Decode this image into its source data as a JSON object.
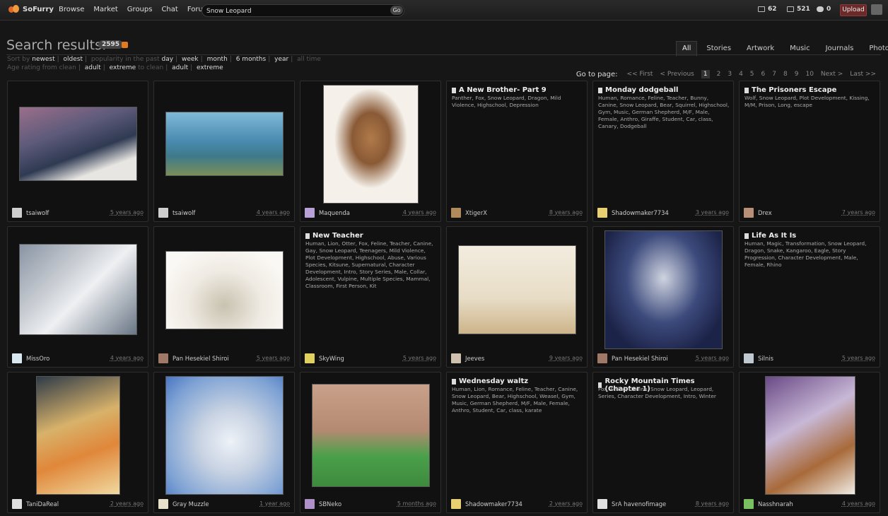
{
  "brand": {
    "name": "SoFurry"
  },
  "nav": [
    "Browse",
    "Market",
    "Groups",
    "Chat",
    "Forum"
  ],
  "search": {
    "value": "Snow Leopard",
    "go_label": "Go"
  },
  "stats": {
    "submissions": "62",
    "messages": "521",
    "comments": "0"
  },
  "upload_label": "Upload",
  "header": {
    "title": "Search results:",
    "count": "2595"
  },
  "tabs": [
    "All",
    "Stories",
    "Artwork",
    "Music",
    "Journals",
    "Photos"
  ],
  "sort": {
    "label": "Sort by",
    "options": [
      "newest",
      "oldest",
      "popularity in the past",
      "day",
      "week",
      "month",
      "6 months",
      "year",
      "all time"
    ]
  },
  "rating": {
    "label": "Age rating from",
    "from": [
      "clean",
      "adult",
      "extreme"
    ],
    "to_label": "to",
    "to": [
      "clean",
      "adult",
      "extreme"
    ]
  },
  "pager": {
    "label": "Go to page:",
    "first": "<< First",
    "prev": "< Previous",
    "pages": [
      "1",
      "2",
      "3",
      "4",
      "5",
      "6",
      "7",
      "8",
      "9",
      "10"
    ],
    "next": "Next >",
    "last": "Last >>"
  },
  "colors": {
    "accent": "#6b2a2a",
    "bg": "#161616",
    "card": "#111111"
  },
  "cards": [
    {
      "type": "art",
      "user": "tsaiwolf",
      "age": "5 years ago"
    },
    {
      "type": "art",
      "user": "tsaiwolf",
      "age": "4 years ago"
    },
    {
      "type": "art",
      "user": "Maquenda",
      "age": "4 years ago"
    },
    {
      "type": "story",
      "title": "A New Brother- Part 9",
      "tags": "Panther, Fox, Snow Leopard, Dragon, Mild Violence, Highschool, Depression",
      "user": "XtigerX",
      "age": "8 years ago"
    },
    {
      "type": "story",
      "title": "Monday dodgeball",
      "tags": "Human, Romance, Feline, Teacher, Bunny, Canine, Snow Leopard, Bear, Squirrel, Highschool, Gym, Music, German Shepherd, M/F, Male, Female, Anthro, Giraffe, Student, Car, class, Canary, Dodgeball",
      "user": "Shadowmaker7734",
      "age": "3 years ago"
    },
    {
      "type": "story",
      "title": "The Prisoners Escape",
      "tags": "Wolf, Snow Leopard, Plot Development, Kissing, M/M, Prison, Long, escape",
      "user": "Drex",
      "age": "7 years ago"
    },
    {
      "type": "art",
      "user": "MissOro",
      "age": "4 years ago"
    },
    {
      "type": "art",
      "user": "Pan Hesekiel Shiroi",
      "age": "5 years ago"
    },
    {
      "type": "story",
      "title": "New Teacher",
      "tags": "Human, Lion, Otter, Fox, Feline, Teacher, Canine, Gay, Snow Leopard, Teenagers, Mild Violence, Plot Development, Highschool, Abuse, Various Species, Kitsune, Supernatural, Character Development, Intro, Story Series, Male, Collar, Adolescent, Vulpine, Multiple Species, Mammal, Classroom, First Person, Kit",
      "user": "SkyWing",
      "age": "5 years ago"
    },
    {
      "type": "art",
      "user": "Jeeves",
      "age": "9 years ago"
    },
    {
      "type": "art",
      "user": "Pan Hesekiel Shiroi",
      "age": "5 years ago"
    },
    {
      "type": "story",
      "title": "Life As It Is",
      "tags": "Human, Magic, Transformation, Snow Leopard, Dragon, Snake, Kangaroo, Eagle, Story Progression, Character Development, Male, Female, Rhino",
      "user": "Silnis",
      "age": "5 years ago"
    },
    {
      "type": "art",
      "user": "TaniDaReal",
      "age": "2 years ago"
    },
    {
      "type": "art",
      "user": "Gray Muzzle",
      "age": "1 year ago"
    },
    {
      "type": "art",
      "user": "SBNeko",
      "age": "5 months ago"
    },
    {
      "type": "story",
      "title": "Wednesday waltz",
      "tags": "Human, Lion, Romance, Feline, Teacher, Canine, Snow Leopard, Bear, Highschool, Weasel, Gym, Music, German Shepherd, M/F, Male, Female, Anthro, Student, Car, class, karate",
      "user": "Shadowmaker7734",
      "age": "2 years ago"
    },
    {
      "type": "story",
      "title": "Rocky Mountain Times (Chapter 1)",
      "tags": "Fox, Feline, Canine, Snow Leopard, Leopard, Series, Character Development, Intro, Winter",
      "user": "SrA havenofimage",
      "age": "8 years ago"
    },
    {
      "type": "art",
      "user": "Nasshnarah",
      "age": "4 years ago"
    }
  ]
}
